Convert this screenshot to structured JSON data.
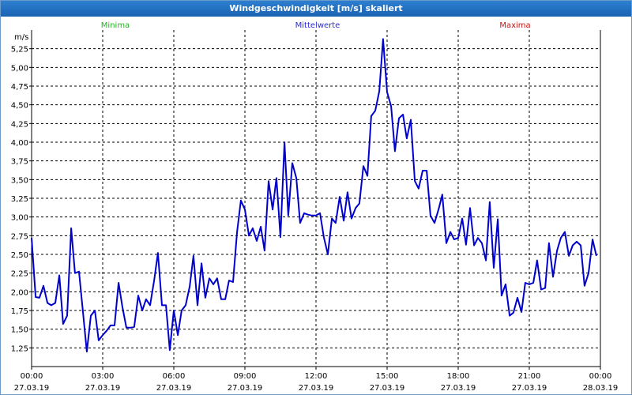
{
  "window": {
    "title": "Windgeschwindigkeit [m/s] skaliert"
  },
  "legend": {
    "minima": {
      "label": "Minima",
      "color": "#22b322"
    },
    "mittel": {
      "label": "Mittelwerte",
      "color": "#2a2ad0"
    },
    "maxima": {
      "label": "Maxima",
      "color": "#cc1111"
    }
  },
  "chart_data": {
    "type": "line",
    "title": "Windgeschwindigkeit [m/s] skaliert",
    "ylabel": "m/s",
    "ylim": [
      1.0,
      5.5
    ],
    "y_ticks": [
      "1,25",
      "1,50",
      "1,75",
      "2,00",
      "2,25",
      "2,50",
      "2,75",
      "3,00",
      "3,25",
      "3,50",
      "3,75",
      "4,00",
      "4,25",
      "4,50",
      "4,75",
      "5,00",
      "5,25"
    ],
    "y_tick_values": [
      1.25,
      1.5,
      1.75,
      2.0,
      2.25,
      2.5,
      2.75,
      3.0,
      3.25,
      3.5,
      3.75,
      4.0,
      4.25,
      4.5,
      4.75,
      5.0,
      5.25
    ],
    "x_ticks": [
      {
        "time": "00:00",
        "date": "27.03.19",
        "h": 0
      },
      {
        "time": "03:00",
        "date": "27.03.19",
        "h": 3
      },
      {
        "time": "06:00",
        "date": "27.03.19",
        "h": 6
      },
      {
        "time": "09:00",
        "date": "27.03.19",
        "h": 9
      },
      {
        "time": "12:00",
        "date": "27.03.19",
        "h": 12
      },
      {
        "time": "15:00",
        "date": "27.03.19",
        "h": 15
      },
      {
        "time": "18:00",
        "date": "27.03.19",
        "h": 18
      },
      {
        "time": "21:00",
        "date": "27.03.19",
        "h": 21
      },
      {
        "time": "00:00",
        "date": "28.03.19",
        "h": 24
      }
    ],
    "xlim": [
      0,
      24
    ],
    "grid": true,
    "series": [
      {
        "name": "Mittelwerte",
        "color": "#0000cc",
        "hours": [
          0,
          0.17,
          0.33,
          0.5,
          0.67,
          0.83,
          1.0,
          1.17,
          1.33,
          1.5,
          1.67,
          1.83,
          2.0,
          2.17,
          2.33,
          2.5,
          2.67,
          2.83,
          3.0,
          3.17,
          3.33,
          3.5,
          3.67,
          3.83,
          4.0,
          4.17,
          4.33,
          4.5,
          4.67,
          4.83,
          5.0,
          5.17,
          5.33,
          5.5,
          5.67,
          5.83,
          6.0,
          6.17,
          6.33,
          6.5,
          6.67,
          6.83,
          7.0,
          7.17,
          7.33,
          7.5,
          7.67,
          7.83,
          8.0,
          8.17,
          8.33,
          8.5,
          8.67,
          8.83,
          9.0,
          9.17,
          9.33,
          9.5,
          9.67,
          9.83,
          10.0,
          10.17,
          10.33,
          10.5,
          10.67,
          10.83,
          11.0,
          11.17,
          11.33,
          11.5,
          11.67,
          11.83,
          12.0,
          12.17,
          12.33,
          12.5,
          12.67,
          12.83,
          13.0,
          13.17,
          13.33,
          13.5,
          13.67,
          13.83,
          14.0,
          14.17,
          14.33,
          14.5,
          14.67,
          14.83,
          15.0,
          15.17,
          15.33,
          15.5,
          15.67,
          15.83,
          16.0,
          16.17,
          16.33,
          16.5,
          16.67,
          16.83,
          17.0,
          17.17,
          17.33,
          17.5,
          17.67,
          17.83,
          18.0,
          18.17,
          18.33,
          18.5,
          18.67,
          18.83,
          19.0,
          19.17,
          19.33,
          19.5,
          19.67,
          19.83,
          20.0,
          20.17,
          20.33,
          20.5,
          20.67,
          20.83,
          21.0,
          21.17,
          21.33,
          21.5,
          21.67,
          21.83,
          22.0,
          22.17,
          22.33,
          22.5,
          22.67,
          22.83,
          23.0,
          23.17,
          23.33,
          23.5,
          23.67,
          23.83
        ],
        "values": [
          2.72,
          1.93,
          1.92,
          2.08,
          1.85,
          1.82,
          1.85,
          2.22,
          1.57,
          1.68,
          2.85,
          2.25,
          2.27,
          1.72,
          1.2,
          1.68,
          1.75,
          1.35,
          1.42,
          1.48,
          1.55,
          1.55,
          2.12,
          1.8,
          1.52,
          1.52,
          1.53,
          1.95,
          1.75,
          1.9,
          1.82,
          2.15,
          2.52,
          1.82,
          1.82,
          1.22,
          1.75,
          1.42,
          1.75,
          1.82,
          2.07,
          2.48,
          1.82,
          2.38,
          1.92,
          2.18,
          2.1,
          2.18,
          1.9,
          1.9,
          2.15,
          2.13,
          2.8,
          3.22,
          3.1,
          2.75,
          2.85,
          2.68,
          2.87,
          2.55,
          3.48,
          3.1,
          3.52,
          2.73,
          4.0,
          3.02,
          3.72,
          3.52,
          2.92,
          3.05,
          3.03,
          3.02,
          3.02,
          3.05,
          2.73,
          2.5,
          2.98,
          2.92,
          3.27,
          2.95,
          3.33,
          2.98,
          3.12,
          3.18,
          3.68,
          3.55,
          4.35,
          4.42,
          4.68,
          5.38,
          4.67,
          4.48,
          3.88,
          4.32,
          4.37,
          4.05,
          4.3,
          3.48,
          3.38,
          3.62,
          3.62,
          3.02,
          2.92,
          3.1,
          3.3,
          2.65,
          2.8,
          2.7,
          2.72,
          2.98,
          2.63,
          3.12,
          2.62,
          2.72,
          2.65,
          2.42,
          3.2,
          2.32,
          2.97,
          1.95,
          2.1,
          1.68,
          1.72,
          1.92,
          1.73,
          2.12,
          2.1,
          2.12,
          2.42,
          2.03,
          2.05,
          2.65,
          2.2,
          2.55,
          2.72,
          2.8,
          2.48,
          2.62,
          2.67,
          2.62,
          2.08,
          2.25,
          2.7,
          2.48
        ]
      }
    ]
  }
}
